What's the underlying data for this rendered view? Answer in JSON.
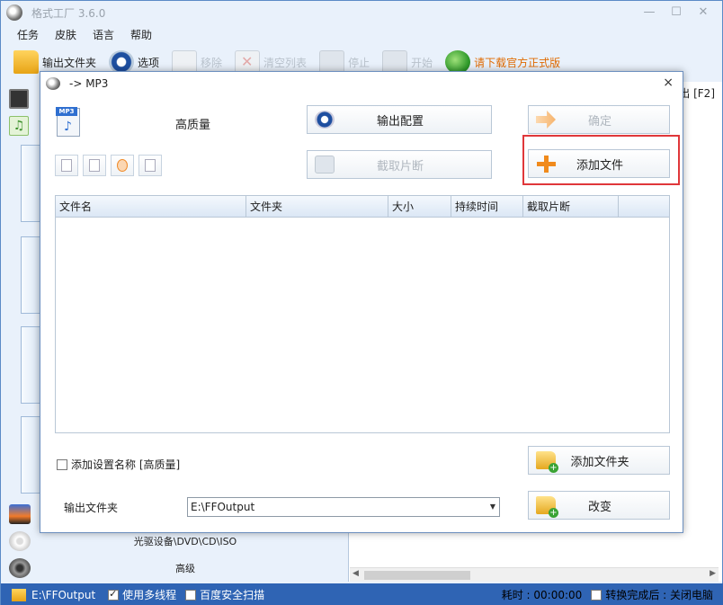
{
  "app": {
    "title": "格式工厂 3.6.0"
  },
  "window_controls": {
    "minimize": "—",
    "maximize": "☐",
    "close": "✕"
  },
  "menu": [
    "任务",
    "皮肤",
    "语言",
    "帮助"
  ],
  "toolbar": {
    "output_folder": "输出文件夹",
    "options": "选项",
    "remove": "移除",
    "clear_list": "清空列表",
    "stop": "停止",
    "start": "开始",
    "download": "请下载官方正式版"
  },
  "right_header": "出 [F2]",
  "bottom_list": {
    "optical": "光驱设备\\DVD\\CD\\ISO",
    "advanced": "高级"
  },
  "statusbar": {
    "folder": "E:\\FFOutput",
    "multithread": "使用多线程",
    "baidu_scan": "百度安全扫描",
    "elapsed": "耗时 : 00:00:00",
    "after_done": "转换完成后 : 关闭电脑"
  },
  "dialog": {
    "title": "-> MP3",
    "close": "×",
    "format_icon_tag": "MP3",
    "quality": "高质量",
    "output_config": "输出配置",
    "ok": "确定",
    "clip": "截取片断",
    "add_file": "添加文件",
    "add_folder": "添加文件夹",
    "change": "改变",
    "add_setting_name": "添加设置名称 [高质量]",
    "output_folder_label": "输出文件夹",
    "output_folder_value": "E:\\FFOutput",
    "columns": [
      "文件名",
      "文件夹",
      "大小",
      "持续时间",
      "截取片断"
    ]
  },
  "colors": {
    "accent_blue": "#2f64b4",
    "highlight_red": "#e0373a",
    "plus_orange": "#f08a1c"
  }
}
